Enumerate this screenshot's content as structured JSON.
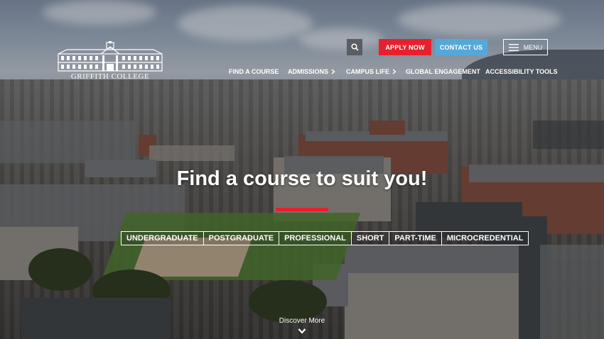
{
  "header": {
    "logo_text": "GRIFFITH COLLEGE",
    "apply_label": "APPLY NOW",
    "contact_label": "CONTACT US",
    "menu_label": "MENU",
    "colors": {
      "apply": "#e8202e",
      "contact": "#56a8d8"
    }
  },
  "nav": {
    "find_course": "FIND A COURSE",
    "admissions": "ADMISSIONS",
    "campus_life": "CAMPUS LIFE",
    "global_engagement": "GLOBAL ENGAGEMENT",
    "accessibility_tools": "ACCESSIBILITY TOOLS"
  },
  "hero": {
    "title": "Find a course to suit you!",
    "courses": [
      "UNDERGRADUATE",
      "POSTGRADUATE",
      "PROFESSIONAL",
      "SHORT",
      "PART-TIME",
      "MICROCREDENTIAL"
    ],
    "discover_label": "Discover More"
  },
  "icons": {
    "search": "search-icon",
    "menu": "hamburger-icon",
    "nav_chevron": "chevron-right-icon",
    "discover": "chevron-down-icon"
  }
}
